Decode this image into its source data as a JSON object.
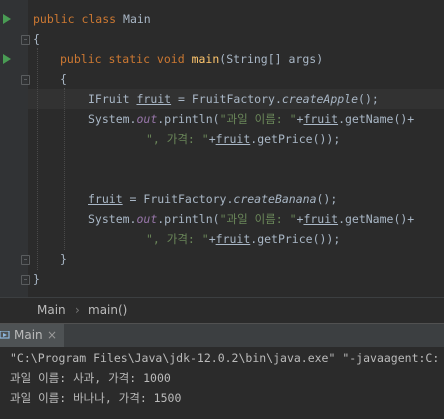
{
  "editor": {
    "lines": [
      {
        "parts": [
          [
            "kw",
            "public class "
          ],
          [
            "",
            "Main"
          ]
        ]
      },
      {
        "parts": [
          [
            "",
            "{"
          ]
        ]
      },
      {
        "parts": [
          [
            "kw",
            "public static void "
          ],
          [
            "fn",
            "main"
          ],
          [
            "",
            "(String[] args)"
          ]
        ]
      },
      {
        "parts": [
          [
            "",
            "{"
          ]
        ]
      },
      {
        "parts": [
          [
            "",
            "IFruit "
          ],
          [
            "ul",
            "fruit"
          ],
          [
            "",
            " = FruitFactory."
          ],
          [
            "it",
            "createApple"
          ],
          [
            "",
            "();"
          ]
        ]
      },
      {
        "parts": [
          [
            "",
            "System."
          ],
          [
            "fld",
            "out"
          ],
          [
            "",
            ".println("
          ],
          [
            "str",
            "\"과일 이름: \""
          ],
          [
            "",
            "+"
          ],
          [
            "ul",
            "fruit"
          ],
          [
            "",
            ".getName()+"
          ]
        ]
      },
      {
        "parts": [
          [
            "str",
            "\", 가격: \""
          ],
          [
            "",
            "+"
          ],
          [
            "ul",
            "fruit"
          ],
          [
            "",
            ".getPrice());"
          ]
        ]
      },
      {
        "parts": [
          [
            "ul",
            "fruit"
          ],
          [
            "",
            " = FruitFactory."
          ],
          [
            "it",
            "createBanana"
          ],
          [
            "",
            "();"
          ]
        ]
      },
      {
        "parts": [
          [
            "",
            "System."
          ],
          [
            "fld",
            "out"
          ],
          [
            "",
            ".println("
          ],
          [
            "str",
            "\"과일 이름: \""
          ],
          [
            "",
            "+"
          ],
          [
            "ul",
            "fruit"
          ],
          [
            "",
            ".getName()+"
          ]
        ]
      },
      {
        "parts": [
          [
            "str",
            "\", 가격: \""
          ],
          [
            "",
            "+"
          ],
          [
            "ul",
            "fruit"
          ],
          [
            "",
            ".getPrice());"
          ]
        ]
      },
      {
        "parts": [
          [
            "",
            "}"
          ]
        ]
      },
      {
        "parts": [
          [
            "",
            "}"
          ]
        ]
      }
    ]
  },
  "breadcrumb": {
    "class_name": "Main",
    "separator": "›",
    "method_name": "main()"
  },
  "run_panel": {
    "tab_label": "Main",
    "close_glyph": "×"
  },
  "console": {
    "lines": [
      "\"C:\\Program Files\\Java\\jdk-12.0.2\\bin\\java.exe\" \"-javaagent:C:",
      "과일 이름: 사과, 가격: 1000",
      "과일 이름: 바나나, 가격: 1500"
    ]
  },
  "colors": {
    "background": "#2b2b2b",
    "keyword": "#cc7832",
    "method": "#ffc66d",
    "string": "#6a8759",
    "field": "#9876aa",
    "text": "#a9b7c6"
  }
}
